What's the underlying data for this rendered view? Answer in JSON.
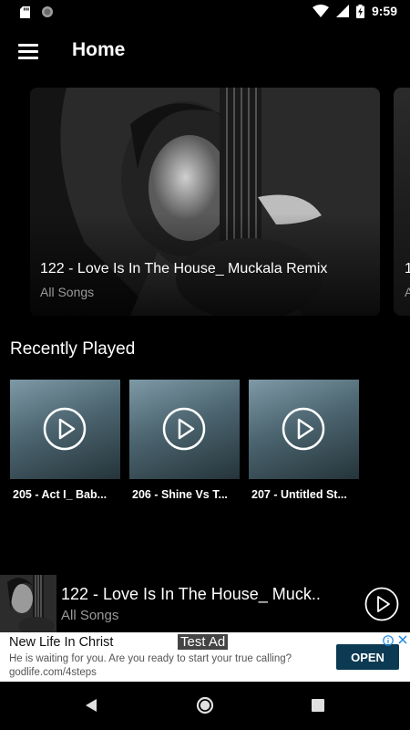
{
  "status_bar": {
    "time": "9:59"
  },
  "app_bar": {
    "title": "Home"
  },
  "hero": {
    "title": "122 - Love Is In The House_ Muckala Remix",
    "subtitle": "All Songs",
    "next_title_peek": "1",
    "next_subtitle_peek": "A"
  },
  "recently_played": {
    "heading": "Recently Played",
    "items": [
      {
        "label": "205 - Act I_ Bab..."
      },
      {
        "label": "206 - Shine Vs T..."
      },
      {
        "label": "207 - Untitled St..."
      }
    ]
  },
  "now_playing": {
    "title": "122 - Love Is In The House_ Muck..",
    "subtitle": "All Songs"
  },
  "ad": {
    "label": "Test Ad",
    "title": "New Life In Christ",
    "text": "He is waiting for you. Are you ready to start your true calling?",
    "url": "godlife.com/4steps",
    "button": "OPEN",
    "accent_color": "#0b3a52"
  },
  "colors": {
    "background": "#000000",
    "secondary_text": "#9a9a9a"
  }
}
